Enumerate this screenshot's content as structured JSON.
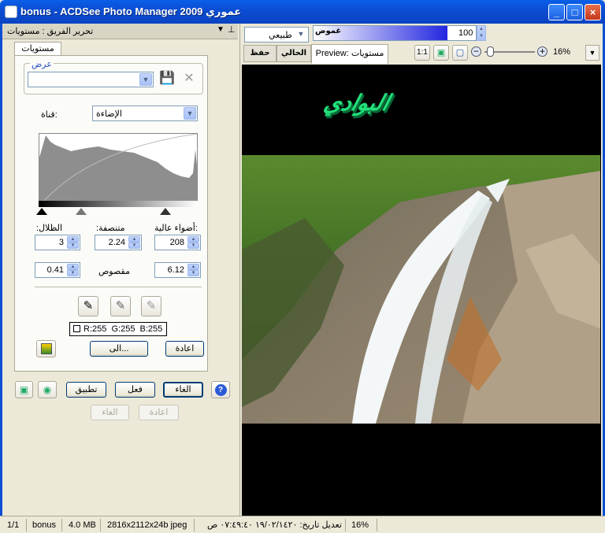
{
  "window": {
    "title": "bonus - ACDSee Photo Manager 2009 عموري",
    "minimize": "_",
    "maximize": "□",
    "close": "×"
  },
  "panel": {
    "header": "تحرير الفريق : مستويات",
    "tab": "مستويات",
    "preset_legend": "عرض",
    "preset_value": "",
    "channel_label": "قناة:",
    "channel_value": "الإضاءة",
    "shadows_label": ":الظلال",
    "midtones_label": ":متنصفة",
    "highlights_label": "أضواء عالية:",
    "shadows_value": "3",
    "midtones_value": "2.24",
    "highlights_value": "208",
    "clip_label": "مقصوص",
    "clip_left": "0.41",
    "clip_right": "6.12",
    "rgb_readout": "R:255  G:255  B:255",
    "auto_button": "الى...",
    "reset_button": "اعادة",
    "cancel_button": "الغاء",
    "done_button": "فعل",
    "apply_button": "تطبيق",
    "undo_button": "الغاء",
    "redo_button": "اعادة"
  },
  "toolbar": {
    "blend_mode": "طبيعي",
    "opacity_label": "غموض",
    "opacity_value": "100",
    "save_tab": "حفظ",
    "current_tab": "الحالي",
    "preview_tab": "Preview: مستويات",
    "zoom_value": "16%",
    "zoom_minus": "−",
    "zoom_plus": "+"
  },
  "image": {
    "watermark_text": "البوادي"
  },
  "status": {
    "page": "1/1",
    "name": "bonus",
    "size": "4.0 MB",
    "dims": "2816x2112x24b jpeg",
    "modified": "تعديل تاريخ: ١٩/٠٢/١٤٢٠ ٠٧:٤٩:٤٠ ص",
    "zoom": "16%"
  },
  "colors": {
    "titlebar": "#0b4ed4",
    "watermark": "#22e07a",
    "viewer_bg": "#000000"
  }
}
